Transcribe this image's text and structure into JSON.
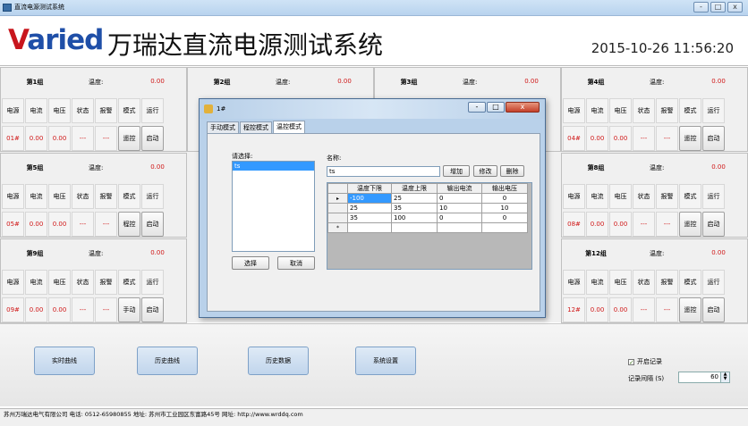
{
  "window": {
    "title": "直流电源测试系统",
    "controls": [
      "-",
      "□",
      "x"
    ]
  },
  "header": {
    "logo_accent": "V",
    "logo_rest": "aried",
    "title": "万瑞达直流电源测试系统",
    "datetime": "2015-10-26 11:56:20"
  },
  "columns": [
    "电源",
    "电流",
    "电压",
    "状态",
    "报警",
    "模式",
    "运行"
  ],
  "temp_label": "温度:",
  "groups": [
    {
      "name": "第1组",
      "temp": "0.00",
      "id": "01#",
      "current": "0.00",
      "voltage": "0.00",
      "status": "---",
      "alarm": "---",
      "mode": "遥控",
      "run": "启动"
    },
    {
      "name": "第2组",
      "temp": "0.00"
    },
    {
      "name": "第3组",
      "temp": "0.00"
    },
    {
      "name": "第4组",
      "temp": "0.00",
      "id": "04#",
      "current": "0.00",
      "voltage": "0.00",
      "status": "---",
      "alarm": "---",
      "mode": "遥控",
      "run": "启动"
    },
    {
      "name": "第5组",
      "temp": "0.00",
      "id": "05#",
      "current": "0.00",
      "voltage": "0.00",
      "status": "---",
      "alarm": "---",
      "mode": "程控",
      "run": "启动"
    },
    {
      "name": "第8组",
      "temp": "0.00",
      "id": "08#",
      "current": "0.00",
      "voltage": "0.00",
      "status": "---",
      "alarm": "---",
      "mode": "遥控",
      "run": "启动"
    },
    {
      "name": "第9组",
      "temp": "0.00",
      "id": "09#",
      "current": "0.00",
      "voltage": "0.00",
      "status": "---",
      "alarm": "---",
      "mode": "手动",
      "run": "启动"
    },
    {
      "name": "第12组",
      "temp": "0.00",
      "id": "12#",
      "current": "0.00",
      "voltage": "0.00",
      "status": "---",
      "alarm": "---",
      "mode": "遥控",
      "run": "启动"
    }
  ],
  "bottom": {
    "buttons": [
      "实时曲线",
      "历史曲线",
      "历史数据",
      "系统设置"
    ],
    "record_label": "开启记录",
    "interval_label": "记录间隔 (S)",
    "interval_value": "60"
  },
  "status": "苏州万瑞达电气有限公司  电话: 0512-65980855  地址: 苏州市工业园区东富路45号  网址: http://www.wrddq.com",
  "dialog": {
    "title": "1#",
    "tabs": [
      "手动模式",
      "程控模式",
      "温控模式"
    ],
    "select_label": "请选择:",
    "list": [
      "ts"
    ],
    "name_label": "名称:",
    "name_value": "ts",
    "buttons": {
      "add": "增加",
      "edit": "修改",
      "delete": "删除",
      "select": "选择",
      "cancel": "取消"
    },
    "table_headers": [
      "温度下限",
      "温度上限",
      "输出电流",
      "输出电压"
    ],
    "rows": [
      [
        "-100",
        "25",
        "0",
        "0"
      ],
      [
        "25",
        "35",
        "10",
        "10"
      ],
      [
        "35",
        "100",
        "0",
        "0"
      ]
    ],
    "new_row_marker": "*",
    "current_marker": "▸"
  }
}
